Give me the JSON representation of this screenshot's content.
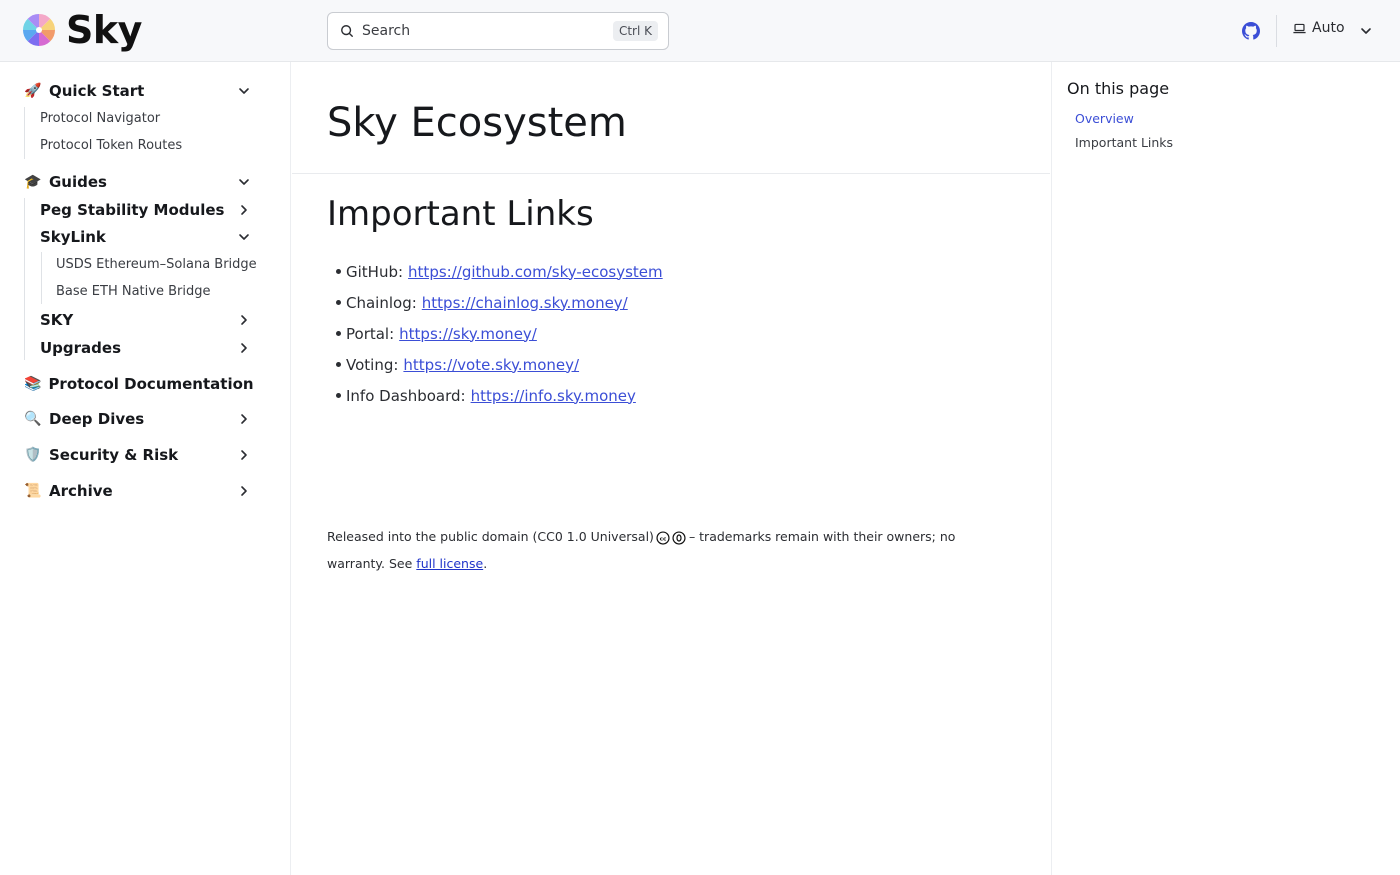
{
  "header": {
    "brand": "Sky",
    "search_placeholder": "Search",
    "search_shortcut": "Ctrl K",
    "theme_label": "Auto",
    "icons": {
      "github": "github-icon",
      "theme": "laptop-icon",
      "search": "search-icon"
    }
  },
  "sidebar": {
    "quick_start": {
      "emoji": "🚀",
      "title": "Quick Start",
      "items": [
        "Protocol Navigator",
        "Protocol Token Routes"
      ]
    },
    "guides": {
      "emoji": "🎓",
      "title": "Guides",
      "peg": "Peg Stability Modules",
      "skylink": {
        "title": "SkyLink",
        "items": [
          "USDS Ethereum–Solana Bridge",
          "Base ETH Native Bridge"
        ]
      },
      "sky": "SKY",
      "upgrades": "Upgrades"
    },
    "protocol_docs": {
      "emoji": "📚",
      "title": "Protocol Documentation"
    },
    "deep_dives": {
      "emoji": "🔍",
      "title": "Deep Dives"
    },
    "security": {
      "emoji": "🛡️",
      "title": "Security & Risk"
    },
    "archive": {
      "emoji": "📜",
      "title": "Archive"
    }
  },
  "main": {
    "title": "Sky Ecosystem",
    "section_heading": "Important Links",
    "links": [
      {
        "label": "GitHub:",
        "url": "https://github.com/sky-ecosystem"
      },
      {
        "label": "Chainlog:",
        "url": "https://chainlog.sky.money/"
      },
      {
        "label": "Portal:",
        "url": "https://sky.money/"
      },
      {
        "label": "Voting:",
        "url": "https://vote.sky.money/"
      },
      {
        "label": "Info Dashboard:",
        "url": "https://info.sky.money"
      }
    ],
    "footer": {
      "text_before": "Released into the public domain (CC0 1.0 Universal)",
      "text_after": "– trademarks remain with their owners; no warranty. See",
      "link_text": "full license",
      "end": "."
    }
  },
  "toc": {
    "title": "On this page",
    "items": [
      {
        "label": "Overview",
        "active": true
      },
      {
        "label": "Important Links",
        "active": false
      }
    ]
  },
  "colors": {
    "accent": "#3b4ed6",
    "header_bg": "#f7f8fa"
  }
}
